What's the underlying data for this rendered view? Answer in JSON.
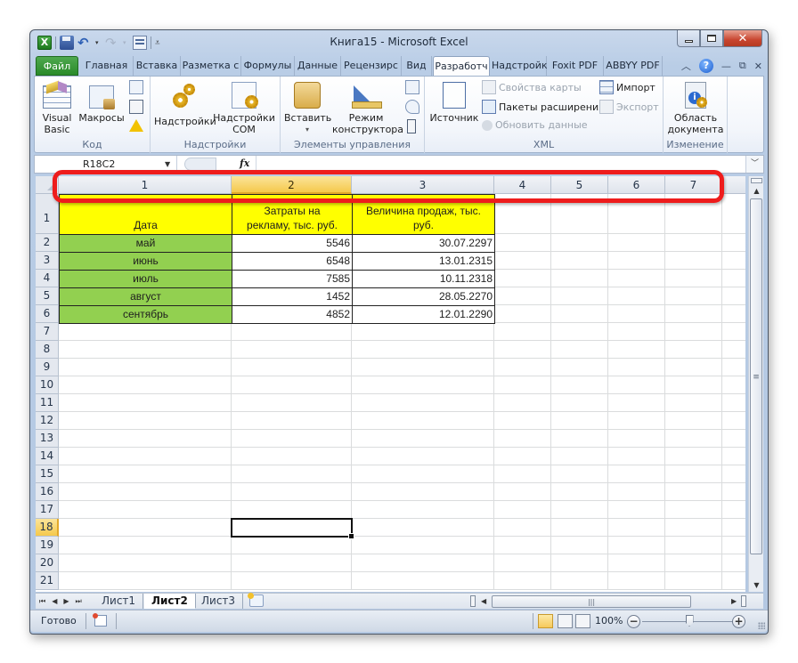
{
  "window": {
    "title": "Книга15  -  Microsoft Excel",
    "controls": {
      "minimize": "—",
      "maximize": "□",
      "close": "✕"
    }
  },
  "quick_access": {
    "icons": [
      "excel-logo",
      "save-icon",
      "undo-icon",
      "redo-icon",
      "form-icon",
      "customize-icon"
    ],
    "excel_letter": "X",
    "undo_glyph": "↶",
    "redo_glyph": "↷",
    "dropdown_glyph": "▾",
    "customize_glyph": "⩡"
  },
  "ribbon_tabs": [
    {
      "label": "Файл",
      "kind": "file"
    },
    {
      "label": "Главная"
    },
    {
      "label": "Вставка"
    },
    {
      "label": "Разметка с"
    },
    {
      "label": "Формулы"
    },
    {
      "label": "Данные"
    },
    {
      "label": "Рецензирс"
    },
    {
      "label": "Вид"
    },
    {
      "label": "Разработч",
      "active": true
    },
    {
      "label": "Надстройк"
    },
    {
      "label": "Foxit PDF"
    },
    {
      "label": "ABBYY PDF"
    }
  ],
  "ribbon_right": {
    "collapse": "ᨓ",
    "help": "?",
    "min": "—",
    "restore": "⧉",
    "close": "✕"
  },
  "ribbon_groups": {
    "code": {
      "label": "Код",
      "visual_basic": "Visual Basic",
      "visual_basic_l1": "Visual",
      "visual_basic_l2": "Basic",
      "macros": "Макросы"
    },
    "addins": {
      "label": "Надстройки",
      "addins_btn": "Надстройки",
      "com_l1": "Надстройки",
      "com_l2": "COM"
    },
    "controls": {
      "label": "Элементы управления",
      "insert": "Вставить",
      "insert_dd": "▾",
      "design_l1": "Режим",
      "design_l2": "конструктора"
    },
    "xml": {
      "label": "XML",
      "source": "Источник",
      "map_properties": "Свойства карты",
      "expansion_packs": "Пакеты расширения",
      "refresh_data": "Обновить данные",
      "import": "Импорт",
      "export": "Экспорт"
    },
    "modify": {
      "label": "Изменение",
      "doc_panel_l1": "Область",
      "doc_panel_l2": "документа"
    }
  },
  "formula_bar": {
    "name_box": "R18C2",
    "fx_label": "fx",
    "formula": "",
    "expand_glyph": "⌄"
  },
  "sheet": {
    "column_headers": [
      "1",
      "2",
      "3",
      "4",
      "5",
      "6",
      "7"
    ],
    "selected_column": "2",
    "row_headers": [
      "1",
      "2",
      "3",
      "4",
      "5",
      "6",
      "7",
      "8",
      "9",
      "10",
      "11",
      "12",
      "13",
      "14",
      "15",
      "16",
      "17",
      "18",
      "19",
      "20",
      "21"
    ],
    "selected_row": "18",
    "selected_cell": "R18C2",
    "table": {
      "headers": [
        "Дата",
        "Затраты на рекламу, тыс. руб.",
        "Величина продаж, тыс. руб."
      ],
      "header_lines": [
        [
          "Дата"
        ],
        [
          "Затраты на",
          "рекламу, тыс. руб."
        ],
        [
          "Величина продаж, тыс.",
          "руб."
        ]
      ],
      "rows": [
        {
          "month": "май",
          "cost": "5546",
          "sales": "30.07.2297"
        },
        {
          "month": "июнь",
          "cost": "6548",
          "sales": "13.01.2315"
        },
        {
          "month": "июль",
          "cost": "7585",
          "sales": "10.11.2318"
        },
        {
          "month": "август",
          "cost": "1452",
          "sales": "28.05.2270"
        },
        {
          "month": "сентябрь",
          "cost": "4852",
          "sales": "12.01.2290"
        }
      ]
    },
    "colors": {
      "header_fill": "#ffff00",
      "month_fill": "#92d050",
      "highlight_ring": "#ee1c1c",
      "selection_header": "#f5c94c"
    }
  },
  "sheet_tabs": {
    "nav": [
      "⏮",
      "◀",
      "▶",
      "⏭"
    ],
    "tabs": [
      {
        "label": "Лист1"
      },
      {
        "label": "Лист2",
        "active": true
      },
      {
        "label": "Лист3"
      }
    ]
  },
  "scrollbars": {
    "up": "▲",
    "down": "▼",
    "left": "◀",
    "right": "▶",
    "grip_v": "≡",
    "grip_h": "|||"
  },
  "status_bar": {
    "status": "Готово",
    "zoom": "100%",
    "zoom_minus": "−",
    "zoom_plus": "+",
    "zoom_level_percent": 100,
    "active_view": "normal"
  }
}
